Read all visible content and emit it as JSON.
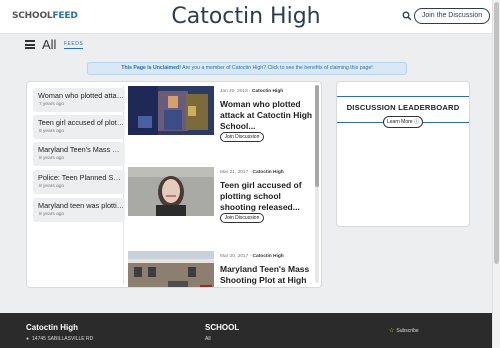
{
  "header": {
    "logo_school": "SCHOOL",
    "logo_feed": "FEED",
    "title": "Catoctin High",
    "join_label": "Join the Discussion"
  },
  "menu": {
    "all_label": "All",
    "feeds_label": "FEEDS"
  },
  "banner": {
    "bold": "This Page is Unclaimed!",
    "text": " Are you a member of Catoctin High? Click to see the benefits of claiming this page!"
  },
  "sidebar": {
    "items": [
      {
        "title": "Woman who plotted attack at Catoctin High School",
        "age": "7 years ago"
      },
      {
        "title": "Teen girl accused of plotting school shooting",
        "age": "8 years ago"
      },
      {
        "title": "Maryland Teen's Mass Shooting Plot",
        "age": "8 years ago"
      },
      {
        "title": "Police: Teen Planned Shooting",
        "age": "8 years ago"
      },
      {
        "title": "Maryland teen was plotting",
        "age": "8 years ago"
      }
    ]
  },
  "articles": [
    {
      "date": "Jan 20, 2018 · ",
      "source": "Catoctin High",
      "title": "Woman who plotted attack at Catoctin High School...",
      "join": "Join Discussion"
    },
    {
      "date": "Mar 21, 2017 · ",
      "source": "Catoctin High",
      "title": "Teen girl accused of plotting school shooting released...",
      "join": "Join Discussion"
    },
    {
      "date": "Mar 20, 2017 · ",
      "source": "Catoctin High",
      "title": "Maryland Teen's Mass Shooting Plot at High School Stopped by ...",
      "join": ""
    }
  ],
  "leaderboard": {
    "title": "DISCUSSION LEADERBOARD",
    "learn_more": "Learn More"
  },
  "footer": {
    "school": "Catoctin High",
    "address": "14745 SABILLASVILLE RD",
    "section": "SCHOOL",
    "all": "All",
    "subscribe": "Subscribe"
  },
  "colors": {
    "brand_blue": "#2a6fb2",
    "title_color": "#2f3e4d",
    "footer_bg": "#2b2b2b"
  }
}
